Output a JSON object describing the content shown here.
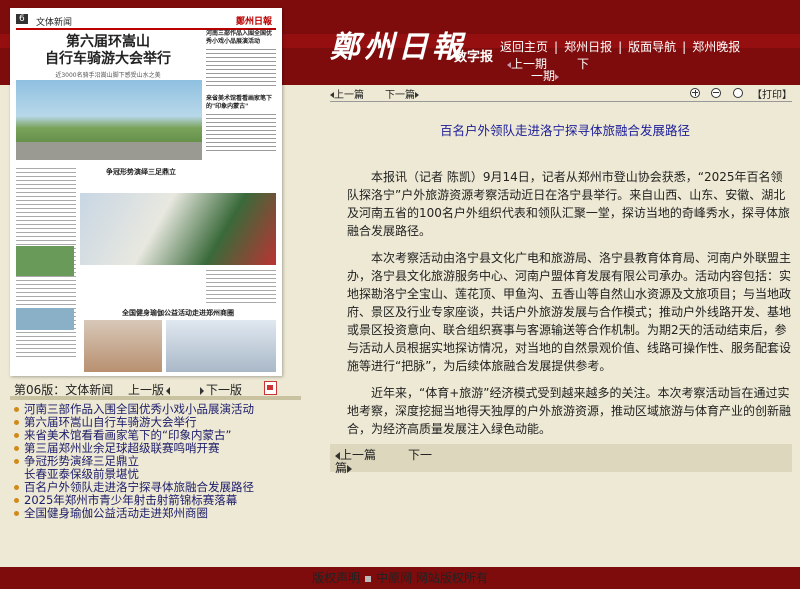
{
  "header": {
    "brand": "鄭州日報",
    "brand_sub": "数字报",
    "nav": [
      "返回主页",
      "郑州日报",
      "版面导航",
      "郑州晚报"
    ],
    "prev_page": "上一期",
    "next_page_top": "下",
    "next_page_bottom": "一期"
  },
  "paper": {
    "page_num": "6",
    "section": "文体新闻",
    "logo": "鄭州日報",
    "headline_1": "第六届环嵩山",
    "headline_2": "自行车骑游大会举行",
    "subline": "近3000名骑手沿嵩山脚下感受山水之美",
    "side_title_1": "河南三部作品入围全国优秀小戏小品展演活动",
    "side_title_2": "来省美术馆看看画家笔下的\"印象内蒙古\"",
    "mid_title_1": "第三届郑州业余足球超级联赛鸣哨开赛",
    "mid_title_2": "争冠形势演绎三足鼎立",
    "left_title": "2025年郑州市青少年射击射箭锦标赛落幕",
    "right_title": "百名户外领队走进洛宁探寻体旅融合发展路径",
    "bottom_title": "全国健身瑜伽公益活动走进郑州商圈"
  },
  "page_caption": {
    "label": "第06版：文体新闻",
    "prev": "上一版",
    "next": "下一版"
  },
  "toc": [
    "河南三部作品入围全国优秀小戏小品展演活动",
    "第六届环嵩山自行车骑游大会举行",
    "来省美术馆看看画家笔下的“印象内蒙古”",
    "第三届郑州业余足球超级联赛鸣哨开赛",
    "争冠形势演绎三足鼎立",
    "长春亚泰保级前景堪忧",
    "百名户外领队走进洛宁探寻体旅融合发展路径",
    "2025年郑州市青少年射击射箭锦标赛落幕",
    "全国健身瑜伽公益活动走进郑州商圈"
  ],
  "article": {
    "toolbar_prev": "上一篇",
    "toolbar_next": "下一篇",
    "print": "【打印】",
    "title": "百名户外领队走进洛宁探寻体旅融合发展路径",
    "paragraphs": [
      "本报讯（记者 陈凯）9月14日，记者从郑州市登山协会获悉，“2025年百名领队探洛宁”户外旅游资源考察活动近日在洛宁县举行。来自山西、山东、安徽、湖北及河南五省的100名户外组织代表和领队汇聚一堂，探访当地的奇峰秀水，探寻体旅融合发展路径。",
      "本次考察活动由洛宁县文化广电和旅游局、洛宁县教育体育局、河南户外联盟主办，洛宁县文化旅游服务中心、河南户盟体育发展有限公司承办。活动内容包括：实地探勘洛宁全宝山、莲花顶、甲鱼沟、五香山等自然山水资源及文旅项目；与当地政府、景区及行业专家座谈，共话户外旅游发展与合作模式；推动户外线路开发、基地或景区投资意向、联合组织赛事与客源输送等合作机制。为期2天的活动结束后，参与活动人员根据实地探访情况，对当地的自然景观价值、线路可操作性、服务配套设施等进行“把脉”，为后续体旅融合发展提供参考。",
      "近年来，“体育+旅游”经济模式受到越来越多的关注。本次考察活动旨在通过实地考察，深度挖掘当地得天独厚的户外旅游资源，推动区域旅游与体育产业的创新融合，为经济高质量发展注入绿色动能。"
    ],
    "bottom_prev": "上一篇",
    "bottom_next_1": "下一",
    "bottom_next_2": "篇"
  },
  "footer": {
    "left": "版权声明",
    "right": "中原网 网站版权所有"
  }
}
